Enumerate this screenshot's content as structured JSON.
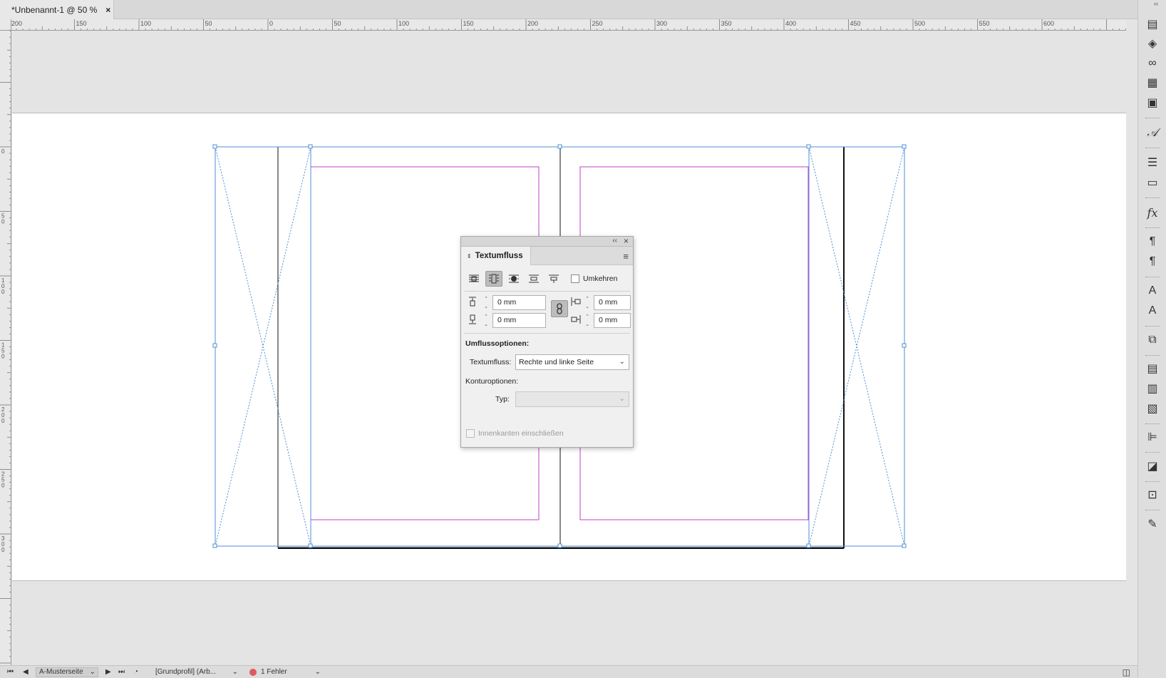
{
  "document_tab": {
    "title": "*Unbenannt-1 @ 50 %",
    "close_glyph": "×"
  },
  "ruler_h": {
    "labels": [
      "200",
      "150",
      "100",
      "50",
      "0",
      "50",
      "100",
      "150",
      "200",
      "250",
      "300",
      "350",
      "400",
      "450",
      "500",
      "550",
      "600"
    ]
  },
  "ruler_v": {
    "labels": [
      "0",
      "5 0",
      "1 0 0",
      "1 5 0",
      "2 0 0",
      "2 5 0",
      "3 0 0"
    ]
  },
  "panel": {
    "tab_title": "Textumfluss",
    "collapse_glyph": "‹‹",
    "close_glyph": "×",
    "menu_glyph": "≡",
    "wrap_modes": [
      "no-wrap-icon",
      "wrap-bounding-box-icon",
      "wrap-object-shape-icon",
      "jump-object-icon",
      "jump-next-column-icon"
    ],
    "active_wrap_mode": 1,
    "invert_label": "Umkehren",
    "offsets": {
      "top": "0 mm",
      "bottom": "0 mm",
      "left": "0 mm",
      "right": "0 mm"
    },
    "wrap_options_label": "Umflussoptionen:",
    "wrap_to_label": "Textumfluss:",
    "wrap_to_value": "Rechte und linke Seite",
    "contour_options_label": "Konturoptionen:",
    "type_label": "Typ:",
    "type_value": "",
    "include_inside_edges_label": "Innenkanten einschließen"
  },
  "statusbar": {
    "page_field": "A-Musterseite",
    "profile": "[Grundprofil] (Arb...",
    "errors": "1 Fehler",
    "error_color": "#e05a5a"
  },
  "colors": {
    "frame_selection": "#4f8fd6",
    "margin_guide": "#c040c0",
    "page_border": "#111111"
  }
}
